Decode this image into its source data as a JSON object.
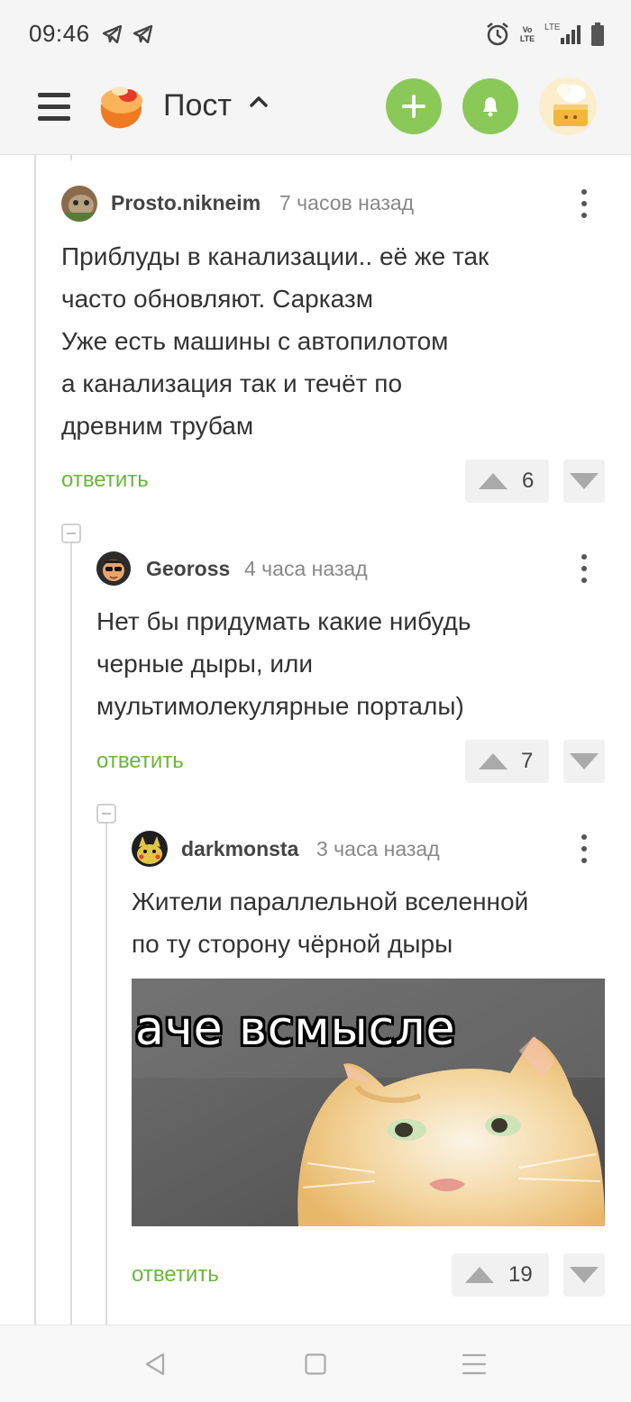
{
  "status_bar": {
    "time": "09:46",
    "network_label_1": "Vo",
    "network_label_2": "LTE",
    "network_label_3": "LTE",
    "icons": [
      "telegram-icon",
      "telegram-icon",
      "alarm-icon",
      "volte-icon",
      "lte-signal-icon",
      "battery-icon"
    ]
  },
  "header": {
    "title": "Пост",
    "icons": [
      "menu-icon",
      "pikabu-logo",
      "chevron-up-icon",
      "plus-icon",
      "bell-icon",
      "user-avatar"
    ]
  },
  "colors": {
    "accent_green": "#8ac858",
    "reply_green": "#6cb63c"
  },
  "comments": [
    {
      "username": "Prosto.nikneim",
      "time": "7 часов назад",
      "lines": [
        "Приблуды в канализации.. её же так",
        "часто обновляют. Сарказм",
        "Уже есть машины с автопилотом",
        "а канализация так и течёт по",
        "древним трубам"
      ],
      "reply_label": "ответить",
      "rating": "6"
    },
    {
      "username": "Geoross",
      "time": "4 часа назад",
      "lines": [
        "Нет бы придумать какие нибудь",
        "черные дыры, или",
        "мультимолекулярные порталы)"
      ],
      "reply_label": "ответить",
      "rating": "7"
    },
    {
      "username": "darkmonsta",
      "time": "3 часа назад",
      "lines": [
        "Жители параллельной вселенной",
        "по ту сторону чёрной дыры"
      ],
      "image_caption": "аче всмысле",
      "reply_label": "ответить",
      "rating": "19"
    }
  ],
  "nav_bar": {
    "icons": [
      "back-icon",
      "home-icon",
      "recents-icon"
    ]
  }
}
